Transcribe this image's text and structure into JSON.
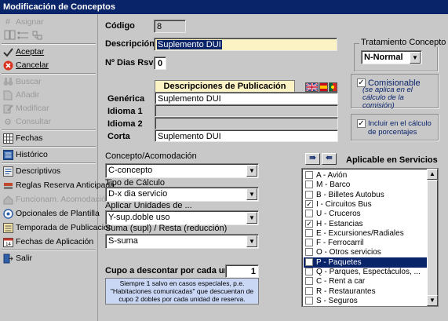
{
  "window": {
    "title": "Modificación de Conceptos"
  },
  "colors": {
    "titlebar": "#0a246a",
    "window_bg": "#c8c8c8",
    "publication_header_bg": "#fbf3c4",
    "note_bg": "#c9d7f5",
    "selection": "#0a246a"
  },
  "sidebar": {
    "items": [
      {
        "label": "Asignar",
        "icon": "hash-icon",
        "enabled": false
      },
      {
        "label": "Aceptar",
        "icon": "checkmark-icon",
        "enabled": true
      },
      {
        "label": "Cancelar",
        "icon": "cancel-icon",
        "enabled": true
      },
      {
        "label": "Buscar",
        "icon": "binoculars-icon",
        "enabled": false
      },
      {
        "label": "Añadir",
        "icon": "add-document-icon",
        "enabled": false
      },
      {
        "label": "Modificar",
        "icon": "pencil-icon",
        "enabled": false
      },
      {
        "label": "Consultar",
        "icon": "gear-icon",
        "enabled": false
      },
      {
        "label": "Fechas",
        "icon": "calendar-grid-icon",
        "enabled": true
      },
      {
        "label": "Histórico",
        "icon": "history-list-icon",
        "enabled": true
      },
      {
        "label": "Descriptivos",
        "icon": "descriptions-icon",
        "enabled": true
      },
      {
        "label": "Reglas Reserva Anticipada",
        "icon": "rules-icon",
        "enabled": true
      },
      {
        "label": "Funcionam. Acomodación",
        "icon": "accommodation-icon",
        "enabled": false
      },
      {
        "label": "Opcionales de Plantilla",
        "icon": "template-icon",
        "enabled": true
      },
      {
        "label": "Temporada de Publicación",
        "icon": "season-icon",
        "enabled": true
      },
      {
        "label": "Fechas de Aplicación",
        "icon": "calendar-14-icon",
        "enabled": true
      },
      {
        "label": "Salir",
        "icon": "exit-icon",
        "enabled": true
      }
    ]
  },
  "form": {
    "codigo_label": "Código",
    "codigo_value": "8",
    "descripcion_label": "Descripción",
    "descripcion_value": "Suplemento DUI",
    "dias_rsva_label": "Nº Dias Rsva.",
    "dias_rsva_value": "0",
    "publicacion": {
      "header": "Descripciones de Publicación",
      "rows": [
        {
          "label": "Genérica",
          "value": "Suplemento DUI"
        },
        {
          "label": "Idioma 1",
          "value": ""
        },
        {
          "label": "Idioma 2",
          "value": ""
        },
        {
          "label": "Corta",
          "value": "Suplemento DUI"
        }
      ]
    },
    "concepto_label": "Concepto/Acomodación",
    "concepto_value": "C-concepto",
    "tipo_calculo_label": "Tipo de Cálculo",
    "tipo_calculo_value": "D-x dia servicio",
    "aplicar_label": "Aplicar Unidades de ...",
    "aplicar_value": "Y-sup.doble uso",
    "suma_label": "Suma (supl) / Resta (reducción)",
    "suma_value": "S-suma",
    "cupo_label": "Cupo a descontar por cada unidad",
    "cupo_value": "1",
    "note": "Siempre 1 salvo en casos especiales, p.e. \"Habitaciones comunicadas\" que descuentan de cupo 2 dobles por cada unidad de reserva."
  },
  "tratamiento": {
    "label": "Tratamiento Concepto",
    "value": "N-Normal"
  },
  "comisionable": {
    "checked": true,
    "label": "Comisionable",
    "sublabel": "(se aplica en el cálculo de la comisión)"
  },
  "porcentajes": {
    "checked": true,
    "label": "Incluir en el cálculo de porcentajes"
  },
  "servicios": {
    "label": "Aplicable en Servicios",
    "nav_next": "⇛",
    "nav_prev": "⇚",
    "items": [
      {
        "label": "A - Avión",
        "checked": false,
        "selected": false
      },
      {
        "label": "M - Barco",
        "checked": false,
        "selected": false
      },
      {
        "label": "B - Billetes Autobus",
        "checked": false,
        "selected": false
      },
      {
        "label": "I - Circuitos Bus",
        "checked": true,
        "selected": false
      },
      {
        "label": "U - Cruceros",
        "checked": false,
        "selected": false
      },
      {
        "label": "H - Estancias",
        "checked": true,
        "selected": false
      },
      {
        "label": "E - Excursiones/Radiales",
        "checked": false,
        "selected": false
      },
      {
        "label": "F - Ferrocarril",
        "checked": false,
        "selected": false
      },
      {
        "label": "O - Otros servicios",
        "checked": false,
        "selected": false
      },
      {
        "label": "P - Paquetes",
        "checked": true,
        "selected": true
      },
      {
        "label": "Q - Parques, Espectáculos, ...",
        "checked": false,
        "selected": false
      },
      {
        "label": "C - Rent a car",
        "checked": false,
        "selected": false
      },
      {
        "label": "R - Restaurantes",
        "checked": false,
        "selected": false
      },
      {
        "label": "S - Seguros",
        "checked": false,
        "selected": false
      }
    ]
  },
  "languages": [
    "uk-flag-icon",
    "spain-flag-icon",
    "portugal-flag-icon"
  ]
}
